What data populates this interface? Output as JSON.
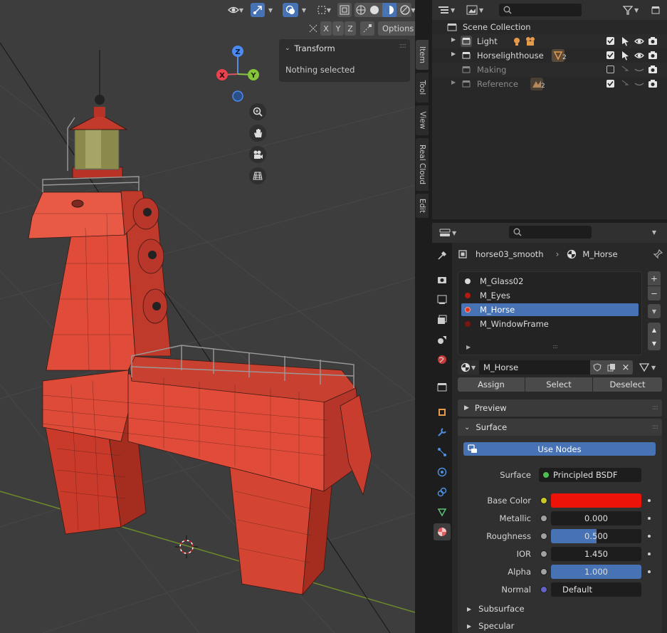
{
  "viewport": {
    "options_label": "Options",
    "axis_x": "X",
    "axis_y": "Y",
    "axis_z": "Z",
    "gizmo_x": "X",
    "gizmo_y": "Y",
    "gizmo_z": "Z",
    "icons": [
      "visibility-icon",
      "gizmo-icon",
      "overlay-icon",
      "xray-icon",
      "wireframe-shading-icon",
      "solid-shading-icon",
      "material-shading-icon",
      "rendered-shading-icon",
      "zoom-icon",
      "hand-icon",
      "camera-icon",
      "grid-icon"
    ]
  },
  "npanel": {
    "title": "Transform",
    "empty_text": "Nothing selected",
    "tabs": [
      "Item",
      "Tool",
      "View",
      "Real Cloud",
      "Edit"
    ]
  },
  "outliner": {
    "root": "Scene Collection",
    "rows": [
      {
        "name": "Light",
        "badge": ""
      },
      {
        "name": "Horselighthouse",
        "badge": "2"
      },
      {
        "name": "Making",
        "badge": ""
      },
      {
        "name": "Reference",
        "badge": "2"
      }
    ]
  },
  "properties": {
    "object_name": "horse03_smooth",
    "material_name": "M_Horse",
    "slots": [
      {
        "name": "M_Glass02",
        "color": "#d9d9d9"
      },
      {
        "name": "M_Eyes",
        "color": "#b51a10"
      },
      {
        "name": "M_Horse",
        "color": "#e3321b"
      },
      {
        "name": "M_WindowFrame",
        "color": "#7a1510"
      }
    ],
    "material_field": "M_Horse",
    "assign": "Assign",
    "select": "Select",
    "deselect": "Deselect",
    "preview": "Preview",
    "surface_header": "Surface",
    "use_nodes": "Use Nodes",
    "surface_label": "Surface",
    "surface_value": "Principled BSDF",
    "base_color_label": "Base Color",
    "base_color": "#ee1309",
    "metallic_label": "Metallic",
    "metallic": "0.000",
    "roughness_label": "Roughness",
    "roughness": "0.500",
    "roughness_fraction": 0.5,
    "ior_label": "IOR",
    "ior": "1.450",
    "alpha_label": "Alpha",
    "alpha": "1.000",
    "alpha_fraction": 1.0,
    "normal_label": "Normal",
    "normal_value": "Default",
    "subsurface": "Subsurface",
    "specular": "Specular",
    "accent": "#4772b3"
  }
}
